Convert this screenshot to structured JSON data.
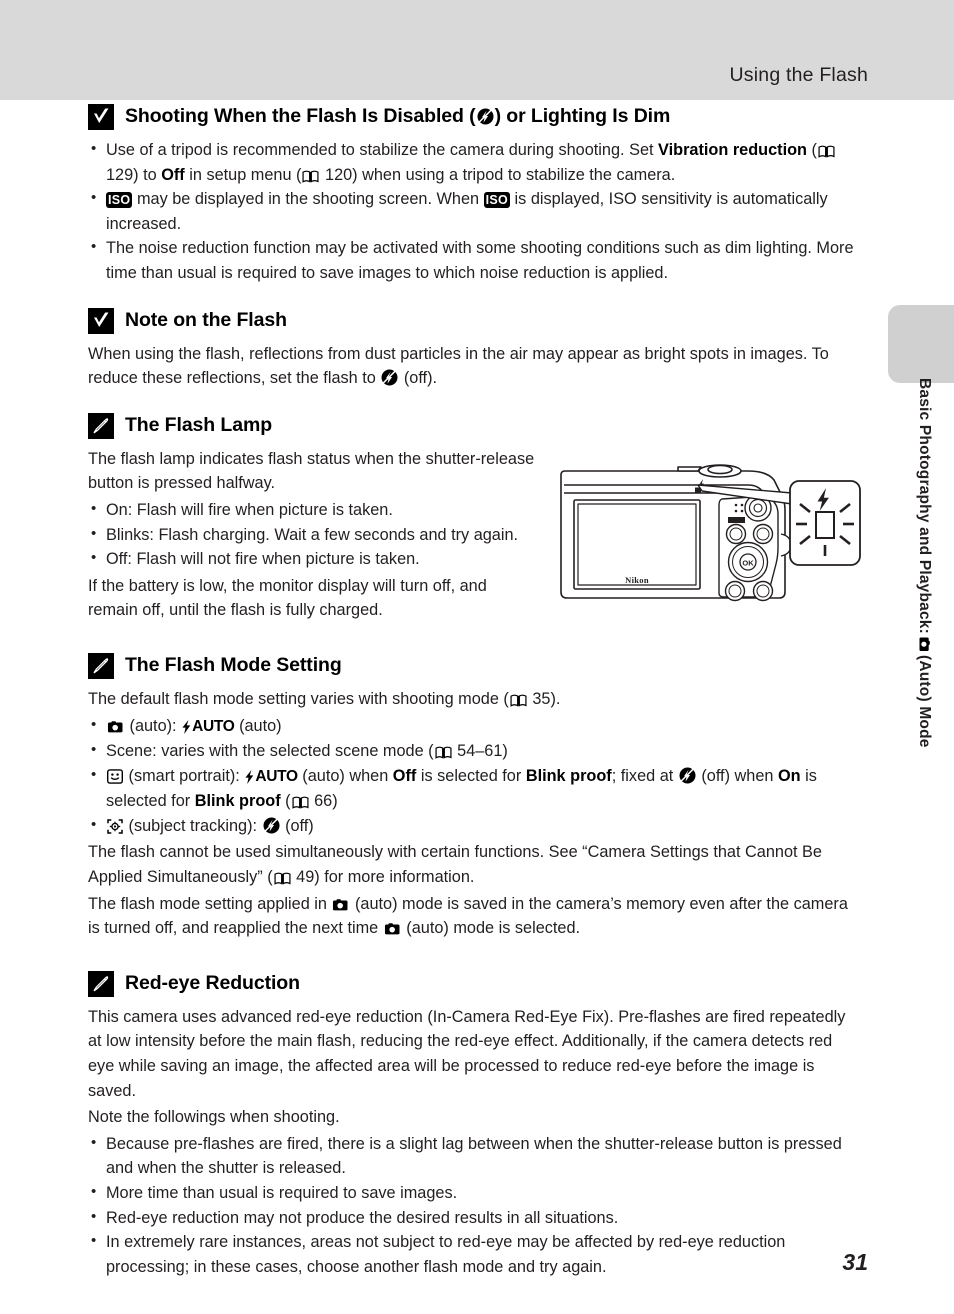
{
  "header": {
    "title": "Using the Flash"
  },
  "side_tab": {
    "label_part1": "Basic Photography and Playback:",
    "label_part2": "(Auto) Mode",
    "icon": "camera-auto-icon"
  },
  "page_number": "31",
  "sections": [
    {
      "id": "flash-disabled",
      "badge": "check-mark-icon",
      "title_pre": "Shooting When the Flash Is Disabled (",
      "title_icon": "flash-off-icon",
      "title_post": ") or Lighting Is Dim",
      "bullets": [
        {
          "parts": [
            {
              "t": "text",
              "v": "Use of a tripod is recommended to stabilize the camera during shooting. Set "
            },
            {
              "t": "bold",
              "v": "Vibration reduction"
            },
            {
              "t": "text",
              "v": " ("
            },
            {
              "t": "icon",
              "v": "book-icon"
            },
            {
              "t": "text",
              "v": " 129) to "
            },
            {
              "t": "bold",
              "v": "Off"
            },
            {
              "t": "text",
              "v": " in setup menu ("
            },
            {
              "t": "icon",
              "v": "book-icon"
            },
            {
              "t": "text",
              "v": " 120) when using a tripod to stabilize the camera."
            }
          ]
        },
        {
          "parts": [
            {
              "t": "iso",
              "v": "ISO"
            },
            {
              "t": "text",
              "v": " may be displayed in the shooting screen. When "
            },
            {
              "t": "iso",
              "v": "ISO"
            },
            {
              "t": "text",
              "v": " is displayed, ISO sensitivity is automatically increased."
            }
          ]
        },
        {
          "parts": [
            {
              "t": "text",
              "v": "The noise reduction function may be activated with some shooting conditions such as dim lighting. More time than usual is required to save images to which noise reduction is applied."
            }
          ]
        }
      ]
    },
    {
      "id": "note-on-flash",
      "badge": "check-mark-icon",
      "title": "Note on the Flash",
      "paragraph_pre": "When using the flash, reflections from dust particles in the air may appear as bright spots in images. To reduce these reflections, set the flash to ",
      "paragraph_icon": "flash-off-icon",
      "paragraph_post": " (off)."
    },
    {
      "id": "flash-lamp",
      "badge": "pencil-icon",
      "title": "The Flash Lamp",
      "intro": "The flash lamp indicates flash status when the shutter-release button is pressed halfway.",
      "bullets": [
        "On: Flash will fire when picture is taken.",
        "Blinks: Flash charging. Wait a few seconds and try again.",
        "Off: Flash will not fire when picture is taken."
      ],
      "outro": "If the battery is low, the monitor display will turn off, and remain off, until the flash is fully charged."
    },
    {
      "id": "flash-mode-setting",
      "badge": "pencil-icon",
      "title": "The Flash Mode Setting",
      "intro_pre": "The default flash mode setting varies with shooting mode (",
      "intro_icon": "book-icon",
      "intro_post": " 35).",
      "closing1_pre": "The flash cannot be used simultaneously with certain functions. See “Camera Settings that Cannot Be Applied Simultaneously” (",
      "closing1_icon": "book-icon",
      "closing1_post": " 49) for more information.",
      "closing2_a": "The flash mode setting applied in ",
      "closing2_icon1": "camera-auto-icon",
      "closing2_b": " (auto) mode is saved in the camera’s memory even after the camera is turned off, and reapplied the next time ",
      "closing2_icon2": "camera-auto-icon",
      "closing2_c": " (auto) mode is selected."
    },
    {
      "id": "red-eye-reduction",
      "badge": "pencil-icon",
      "title": "Red-eye Reduction",
      "para1": "This camera uses advanced red-eye reduction (In-Camera Red-Eye Fix). Pre-flashes are fired repeatedly at low intensity before the main flash, reducing the red-eye effect. Additionally, if the camera detects red eye while saving an image, the affected area will be processed to reduce red-eye before the image is saved.",
      "para2": "Note the followings when shooting.",
      "bullets": [
        "Because pre-flashes are fired, there is a slight lag between when the shutter-release button is pressed and when the shutter is released.",
        "More time than usual is required to save images.",
        "Red-eye reduction may not produce the desired results in all situations.",
        "In extremely rare instances, areas not subject to red-eye may be affected by red-eye reduction processing; in these cases, choose another flash mode and try again."
      ]
    }
  ],
  "flash_mode_list": {
    "item1_icon": "camera-auto-icon",
    "item1_a": " (auto): ",
    "item1_flashauto": "AUTO",
    "item1_b": " (auto)",
    "item2_pre": "Scene: varies with the selected scene mode (",
    "item2_icon": "book-icon",
    "item2_post": " 54–61)",
    "item3_icon": "smart-portrait-icon",
    "item3_a": " (smart portrait): ",
    "item3_flashauto": "AUTO",
    "item3_b": " (auto) when ",
    "item3_off": "Off",
    "item3_c": " is selected for ",
    "item3_blink1": "Blink proof",
    "item3_d": "; fixed at ",
    "item3_icon2": "flash-off-icon",
    "item3_e": " (off) when ",
    "item3_on": "On",
    "item3_f": " is selected for ",
    "item3_blink2": "Blink proof",
    "item3_g": " (",
    "item3_icon3": "book-icon",
    "item3_h": " 66)",
    "item4_icon": "subject-tracking-icon",
    "item4_a": " (subject tracking): ",
    "item4_icon2": "flash-off-icon",
    "item4_b": " (off)"
  },
  "camera_illustration": {
    "brand_label": "Nikon",
    "callout_icon": "flash-lamp-blinking-icon",
    "flash_lamp_marker": "flash-lamp-indicator"
  },
  "colors": {
    "header_band": "#d9d9d9",
    "side_tab": "#d0d0d0",
    "text": "#231f20",
    "badge": "#000000"
  }
}
